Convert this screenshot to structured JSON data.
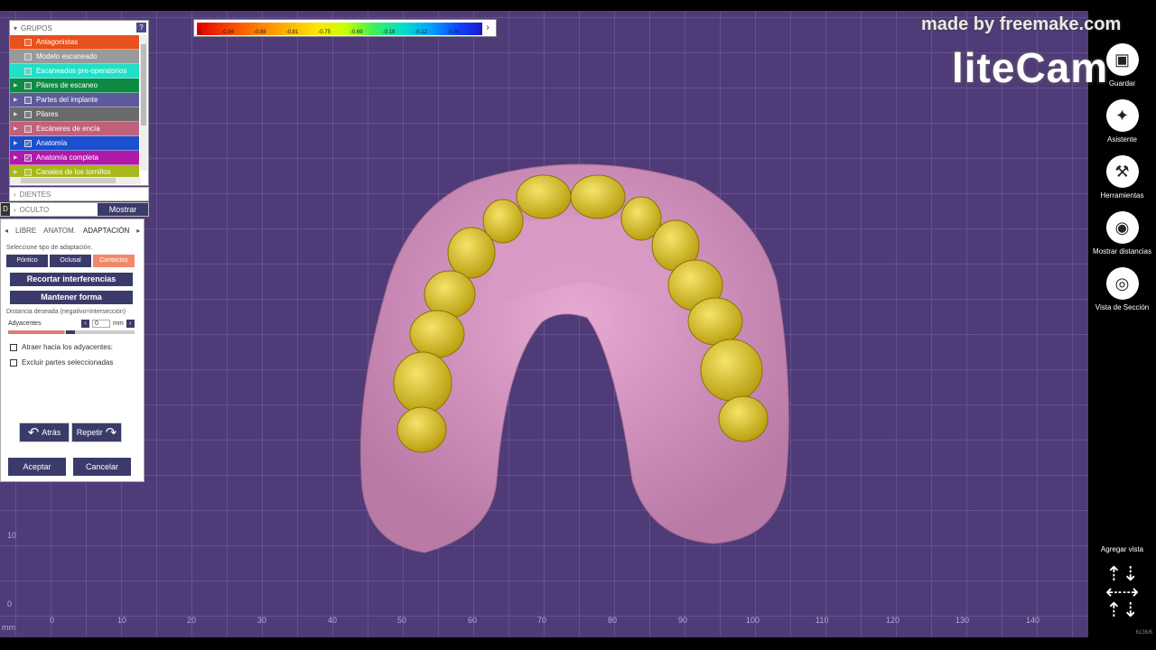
{
  "colorbar": {
    "ticks": [
      "-1",
      "-0.94",
      "-0.88",
      "-0.81",
      "-0.75",
      "-0.69",
      "-0.19",
      "-0.12",
      "-0.06",
      "0"
    ],
    "next_label": "›"
  },
  "groups": {
    "title": "GRUPOS",
    "help": "?",
    "items": [
      {
        "label": "Antagonistas",
        "color": "#e8501c",
        "checked": false,
        "expandable": false
      },
      {
        "label": "Modelo escaneado",
        "color": "#9a9a9a",
        "checked": false,
        "expandable": false
      },
      {
        "label": "Escaneados pre-operatorios",
        "color": "#1fe0c8",
        "checked": false,
        "expandable": false
      },
      {
        "label": "Pilares de escaneo",
        "color": "#0f8a44",
        "checked": false,
        "expandable": true
      },
      {
        "label": "Partes del implante",
        "color": "#5c5a9a",
        "checked": false,
        "expandable": true
      },
      {
        "label": "Pilares",
        "color": "#6a6a6a",
        "checked": false,
        "expandable": true
      },
      {
        "label": "Escáneres de encía",
        "color": "#c0607a",
        "checked": false,
        "expandable": true
      },
      {
        "label": "Anatomía",
        "color": "#1a4fd0",
        "checked": true,
        "expandable": true
      },
      {
        "label": "Anatomía completa",
        "color": "#b01aa8",
        "checked": true,
        "expandable": true
      },
      {
        "label": "Canales de los tornillos",
        "color": "#a8b81a",
        "checked": false,
        "expandable": true
      }
    ]
  },
  "dientes": {
    "label": "DIENTES"
  },
  "oculto": {
    "prefix": "D",
    "label": "OCULTO",
    "button": "Mostrar"
  },
  "adaptation": {
    "tabs": [
      "LIBRE",
      "ANATOM.",
      "ADAPTACIÓN"
    ],
    "select_label": "Seleccione tipo de adaptación.",
    "types": [
      {
        "label": "Póntico",
        "selected": false
      },
      {
        "label": "Oclusal",
        "selected": false
      },
      {
        "label": "Contactos",
        "selected": true
      }
    ],
    "trim_button": "Recortar interferencias",
    "keep_button": "Mantener forma",
    "distance_label": "Distancia deseada (negativo=intersección)",
    "adjacent_label": "Adyacentes",
    "adjacent_value": "0",
    "unit": "mm",
    "slider_value": 0.44,
    "attract_label": "Atraer hacia los adyacentes:",
    "exclude_label": "Excluir partes seleccionadas",
    "undo_label": "Atrás",
    "redo_label": "Repetir",
    "accept_label": "Aceptar",
    "cancel_label": "Cancelar"
  },
  "axis": {
    "x_ticks": [
      "0",
      "10",
      "20",
      "30",
      "40",
      "50",
      "60",
      "70",
      "80",
      "90",
      "100",
      "110",
      "120",
      "130",
      "140"
    ],
    "y_ticks": [
      "10",
      "0"
    ],
    "unit": "mm"
  },
  "toolbar": {
    "save": "Guardar",
    "wizard": "Asistente",
    "tools": "Herramientas",
    "distances": "Mostrar distancias",
    "section": "Vista de Sección",
    "add_view": "Agregar vista"
  },
  "watermark": {
    "line1": "made by freemake.com",
    "line2": "liteCam"
  },
  "version": "6136/6"
}
